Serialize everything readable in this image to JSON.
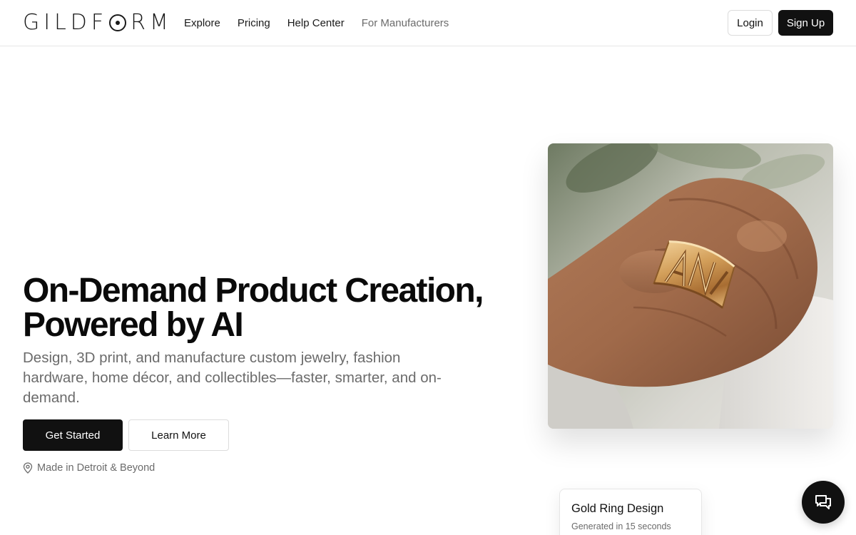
{
  "header": {
    "logo_text": "GILDFORM",
    "nav": [
      {
        "label": "Explore"
      },
      {
        "label": "Pricing"
      },
      {
        "label": "Help Center"
      },
      {
        "label": "For Manufacturers"
      }
    ],
    "login_label": "Login",
    "signup_label": "Sign Up"
  },
  "hero": {
    "title_line1": "On-Demand Product Creation,",
    "title_line2": "Powered by AI",
    "subtitle": "Design, 3D print, and manufacture custom jewelry, fashion hardware, home décor, and collectibles—faster, smarter, and on-demand.",
    "primary_cta": "Get Started",
    "secondary_cta": "Learn More",
    "location_text": "Made in Detroit & Beyond",
    "location_icon": "map-pin-icon"
  },
  "card": {
    "title": "Gold Ring Design",
    "subtitle": "Generated in 15 seconds"
  },
  "chat": {
    "icon": "chat-icon"
  },
  "colors": {
    "primary": "#111111",
    "muted_text": "#6b6b6b",
    "border": "#dcdcdc",
    "gold": "#c9934f"
  }
}
